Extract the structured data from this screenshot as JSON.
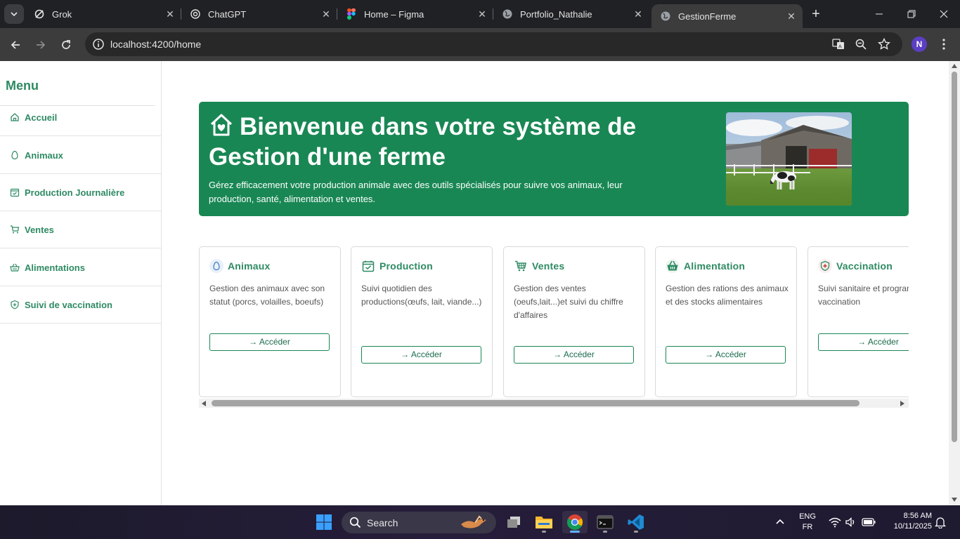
{
  "browser": {
    "tabs": [
      {
        "title": "Grok",
        "icon": "grok-icon"
      },
      {
        "title": "ChatGPT",
        "icon": "chatgpt-icon"
      },
      {
        "title": "Home – Figma",
        "icon": "figma-icon"
      },
      {
        "title": "Portfolio_Nathalie",
        "icon": "globe-icon"
      },
      {
        "title": "GestionFerme",
        "icon": "globe-icon",
        "active": true
      }
    ],
    "url": "localhost:4200/home",
    "profile_initial": "N"
  },
  "sidebar": {
    "title": "Menu",
    "items": [
      {
        "label": "Accueil",
        "icon": "house-icon"
      },
      {
        "label": "Animaux",
        "icon": "egg-icon"
      },
      {
        "label": "Production Journalière",
        "icon": "calendar-check-icon"
      },
      {
        "label": "Ventes",
        "icon": "cart-icon"
      },
      {
        "label": "Alimentations",
        "icon": "basket-icon"
      },
      {
        "label": "Suivi de vaccination",
        "icon": "shield-plus-icon"
      }
    ]
  },
  "hero": {
    "title": "Bienvenue dans votre système de Gestion d'une ferme",
    "subtitle": "Gérez efficacement votre production animale avec des outils spécialisés pour suivre vos animaux, leur production, santé, alimentation et ventes.",
    "image": "farm-cow-photo"
  },
  "cards": [
    {
      "title": "Animaux",
      "description": "Gestion des animaux avec son statut (porcs, volailles, boeufs)",
      "button": "→ Accéder",
      "icon": "egg-icon"
    },
    {
      "title": "Production",
      "description": "Suivi quotidien des productions(œufs, lait, viande...)",
      "button": "→ Accéder",
      "icon": "calendar-check-icon"
    },
    {
      "title": "Ventes",
      "description": "Gestion des ventes (oeufs,lait...)et suivi du chiffre d'affaires",
      "button": "→ Accéder",
      "icon": "cart-icon"
    },
    {
      "title": "Alimentation",
      "description": "Gestion des rations des animaux et des stocks alimentaires",
      "button": "→ Accéder",
      "icon": "basket-icon"
    },
    {
      "title": "Vaccination",
      "description": "Suivi sanitaire et programme de vaccination",
      "button": "→ Accéder",
      "icon": "shield-plus-icon"
    }
  ],
  "taskbar": {
    "search_label": "Search",
    "lang_line1": "ENG",
    "lang_line2": "FR",
    "time": "8:56 AM",
    "date": "10/11/2025"
  },
  "colors": {
    "primary_green": "#198754",
    "text_green": "#2e8a63",
    "tab_bar": "#202124",
    "address_bar": "#3c3c3c"
  }
}
